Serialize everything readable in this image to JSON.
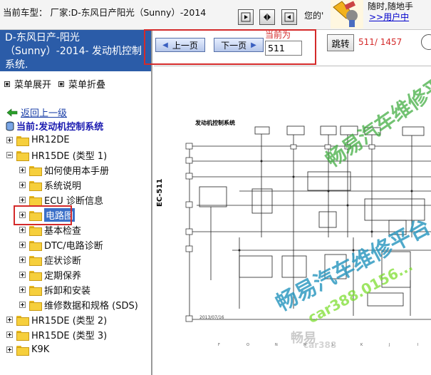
{
  "topbar": {
    "vehicle_line": "当前车型： 厂家:D-东风日产阳光（Sunny）-2014",
    "greeting": "您的'",
    "slogan": "随时,随地手",
    "user_center": ">>用户中",
    "buttons": [
      {
        "icon": "play-right-icon"
      },
      {
        "icon": "fit-arrows-icon"
      },
      {
        "icon": "play-left-icon"
      }
    ]
  },
  "sidebar": {
    "vehicle_header": "D-东风日产-阳光（Sunny）-2014- 发动机控制系统.",
    "expand_all": "菜单展开",
    "collapse_all": "菜单折叠",
    "back_link": "返回上一级",
    "current_system": "当前:发动机控制系统",
    "tree": [
      {
        "label": "HR12DE",
        "level": 0,
        "expanded": false
      },
      {
        "label": "HR15DE (类型 1)",
        "level": 0,
        "expanded": true
      },
      {
        "label": "如何使用本手册",
        "level": 1,
        "expanded": false
      },
      {
        "label": "系统说明",
        "level": 1,
        "expanded": false
      },
      {
        "label": "ECU 诊断信息",
        "level": 1,
        "expanded": false
      },
      {
        "label": "电路图",
        "level": 1,
        "expanded": false,
        "selected": true
      },
      {
        "label": "基本检查",
        "level": 1,
        "expanded": false
      },
      {
        "label": "DTC/电路诊断",
        "level": 1,
        "expanded": false
      },
      {
        "label": "症状诊断",
        "level": 1,
        "expanded": false
      },
      {
        "label": "定期保养",
        "level": 1,
        "expanded": false
      },
      {
        "label": "拆卸和安装",
        "level": 1,
        "expanded": false
      },
      {
        "label": "维修数据和规格 (SDS)",
        "level": 1,
        "expanded": false
      },
      {
        "label": "HR15DE (类型 2)",
        "level": 0,
        "expanded": false
      },
      {
        "label": "HR15DE (类型 3)",
        "level": 0,
        "expanded": false
      },
      {
        "label": "K9K",
        "level": 0,
        "expanded": false
      }
    ]
  },
  "toolbar": {
    "prev_label": "上一页",
    "next_label": "下一页",
    "current_label": "当前为",
    "page_value": "511",
    "jump_label": "跳转",
    "page_count": "511/ 1457",
    "accent_color": "#d42a2a"
  },
  "diagram": {
    "section_code": "EC-511",
    "title": "发动机控制系统",
    "date": "2013/07/16",
    "watermarks": [
      "畅易汽车维修平台",
      "畅易汽车维修平台",
      "car388.0156...",
      "畅易",
      "car388"
    ]
  }
}
